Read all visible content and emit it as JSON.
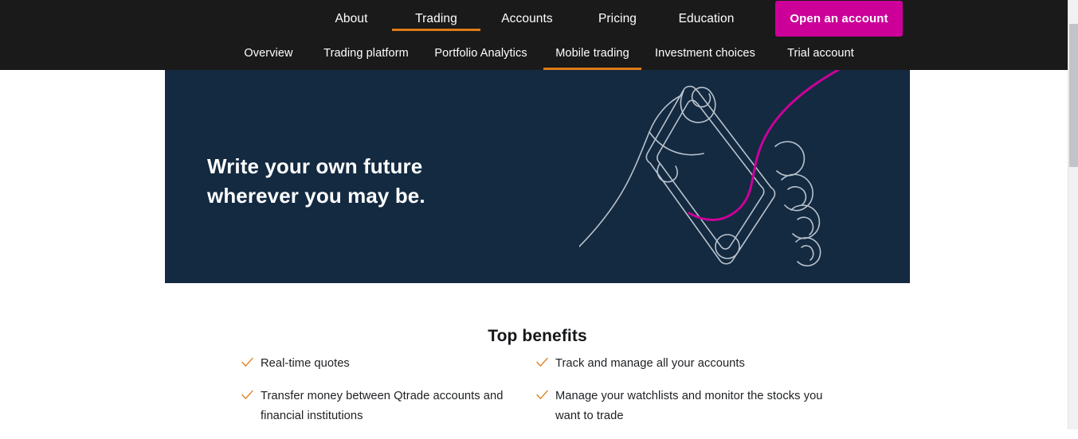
{
  "theme": {
    "header_bg": "#1a1a1a",
    "hero_bg": "#132a41",
    "accent_orange": "#de7b18",
    "accent_magenta": "#cc0099",
    "text_light": "#ffffff",
    "text_dark": "#1d1f22",
    "page_bg": "#ffffff",
    "line_art": "#b9c2cc"
  },
  "header": {
    "primary_nav": [
      {
        "label": "About",
        "active": false
      },
      {
        "label": "Trading",
        "active": true
      },
      {
        "label": "Accounts",
        "active": false
      },
      {
        "label": "Pricing",
        "active": false
      },
      {
        "label": "Education",
        "active": false
      }
    ],
    "cta": {
      "label": "Open an account"
    },
    "secondary_nav": [
      {
        "label": "Overview",
        "active": false
      },
      {
        "label": "Trading platform",
        "active": false
      },
      {
        "label": "Portfolio Analytics",
        "active": false
      },
      {
        "label": "Mobile trading",
        "active": true
      },
      {
        "label": "Investment choices",
        "active": false
      },
      {
        "label": "Trial account",
        "active": false
      }
    ]
  },
  "hero": {
    "title": "Write your own future\nwherever you may be.",
    "illustration_name": "hand-holding-phone-line-art"
  },
  "benefits": {
    "title": "Top benefits",
    "left_column": [
      {
        "text": "Real-time quotes",
        "icon": "check-icon"
      },
      {
        "text": "Transfer money between Qtrade accounts and financial institutions",
        "icon": "check-icon"
      }
    ],
    "right_column": [
      {
        "text": "Track and manage all your accounts",
        "icon": "check-icon"
      },
      {
        "text": "Manage your watchlists and monitor the stocks you want to trade",
        "icon": "check-icon"
      }
    ]
  },
  "scrollbar": {
    "name": "vertical-scrollbar"
  }
}
